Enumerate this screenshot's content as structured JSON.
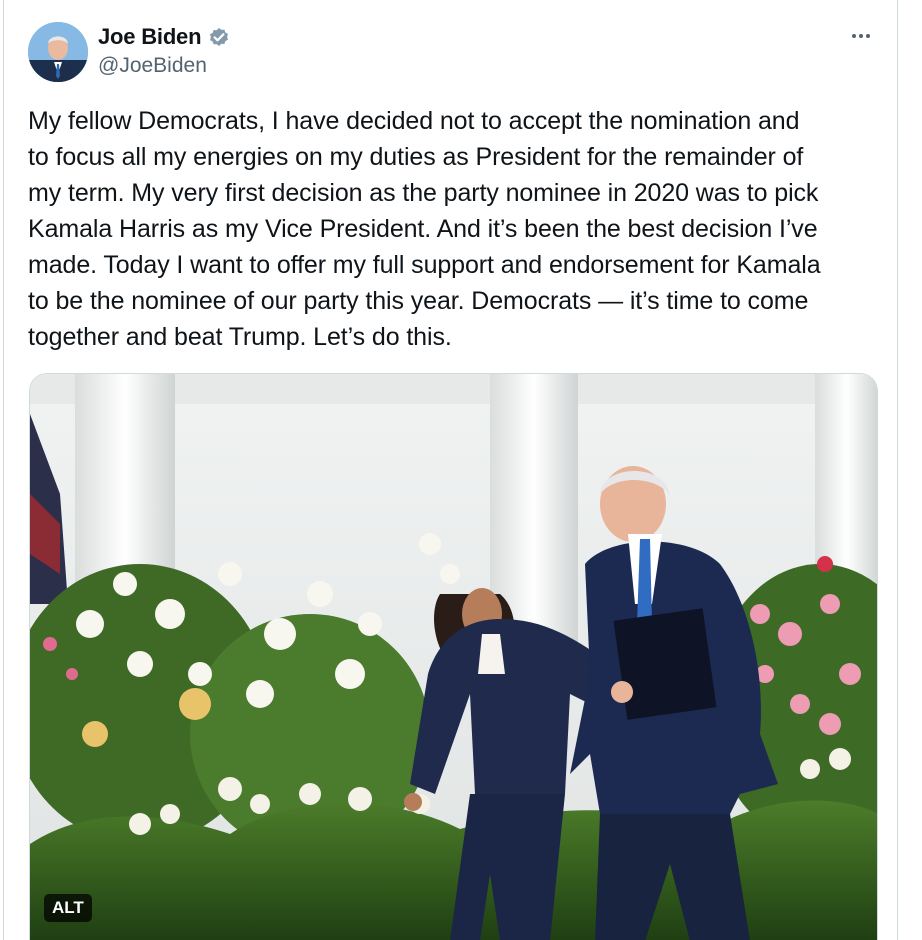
{
  "author": {
    "display_name": "Joe Biden",
    "handle": "@JoeBiden",
    "avatar_icon": "profile-photo",
    "verified_icon": "verified-badge-icon",
    "verified_color": "#829aab"
  },
  "menu": {
    "more_icon": "more-options-icon"
  },
  "tweet": {
    "text": "My fellow Democrats, I have decided not to accept the nomination and\nto focus all my energies on my duties as President for the remainder of\nmy term. My very first decision as the party nominee in 2020 was to pick\nKamala Harris as my Vice President. And it’s been the best decision I’ve\nmade. Today I want to offer my full support and endorsement for Kamala\nto be the nominee of our party this year. Democrats — it’s time to come\ntogether and beat Trump. Let’s do this."
  },
  "media": {
    "alt_label": "ALT"
  },
  "colors": {
    "text": "#0f1419",
    "secondary": "#536471",
    "border": "#cfd9de"
  }
}
